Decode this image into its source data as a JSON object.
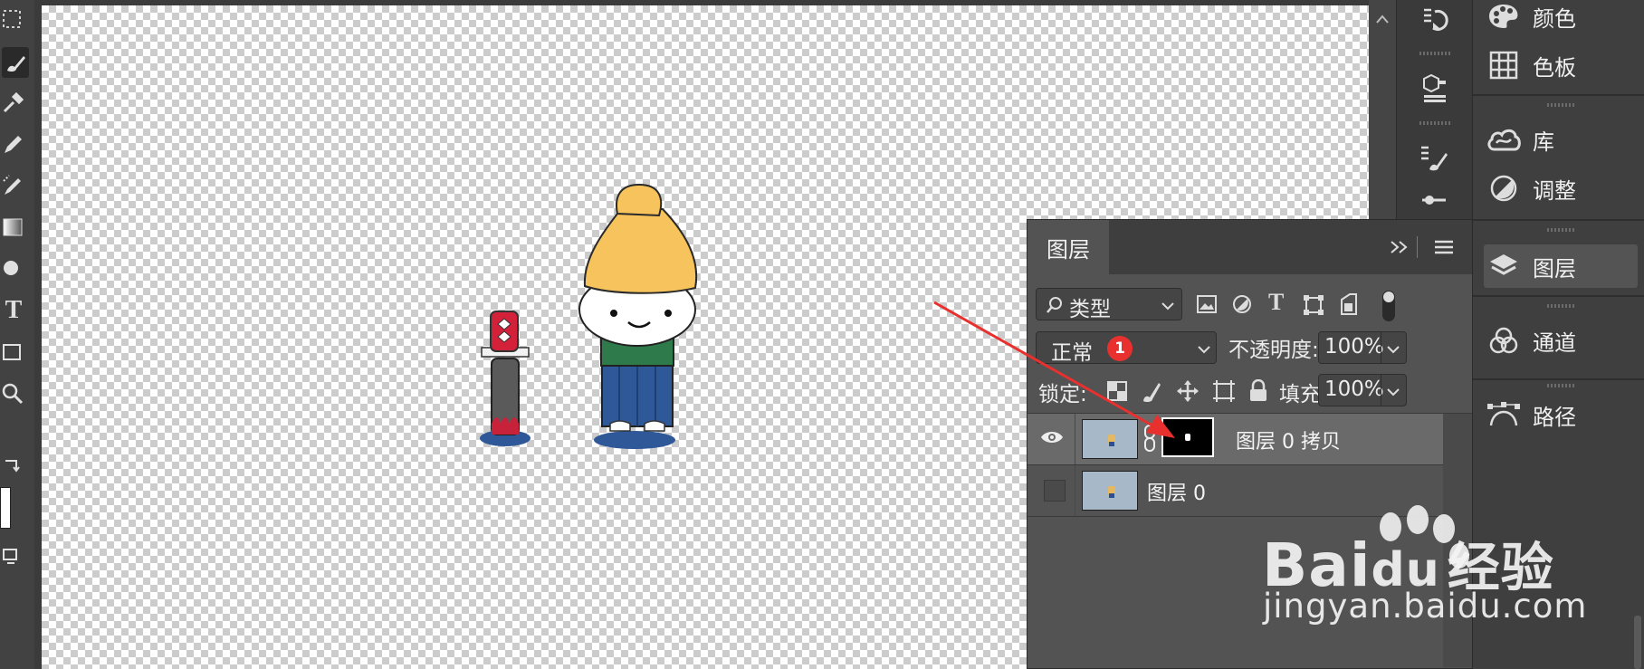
{
  "toolbar": {
    "tools": [
      "marquee-tool",
      "brush-tool",
      "eyedropper-tool",
      "pencil-tool",
      "history-brush-tool",
      "gradient-tool",
      "dodge-tool",
      "type-tool",
      "rectangle-tool",
      "zoom-tool",
      "swap-colors",
      "foreground-color",
      "screen-mode"
    ],
    "type_tool_glyph": "T"
  },
  "right_panels": {
    "items": [
      {
        "label": "颜色",
        "icon": "palette-icon"
      },
      {
        "label": "色板",
        "icon": "swatches-grid-icon"
      },
      {
        "label": "库",
        "icon": "cc-libraries-icon"
      },
      {
        "label": "调整",
        "icon": "adjustment-circle-icon"
      },
      {
        "label": "图层",
        "icon": "layers-stack-icon",
        "active": true
      },
      {
        "label": "通道",
        "icon": "channels-icon"
      },
      {
        "label": "路径",
        "icon": "paths-pen-icon"
      }
    ]
  },
  "layers_panel": {
    "tab_label": "图层",
    "filter_label": "类型",
    "blend_mode": "正常",
    "annotation_number": "1",
    "opacity_label": "不透明度:",
    "opacity_value": "100%",
    "lock_label": "锁定:",
    "fill_label": "填充:",
    "fill_value": "100%",
    "filter_type_glyph": "T",
    "layers": [
      {
        "name": "图层 0 拷贝",
        "visible": true,
        "has_mask": true,
        "selected": true
      },
      {
        "name": "图层 0",
        "visible": false,
        "has_mask": false,
        "selected": false
      }
    ]
  },
  "watermark": {
    "brand_text": "Bai",
    "brand_du": "du",
    "brand_cn": "经验",
    "url": "jingyan.baidu.com"
  },
  "colors": {
    "arrow": "#e8312f",
    "badge": "#e8312f",
    "hat": "#f6c35c",
    "hakama": "#2f5899",
    "kimono": "#2e7a4a",
    "sword_hilt": "#d3213a"
  }
}
